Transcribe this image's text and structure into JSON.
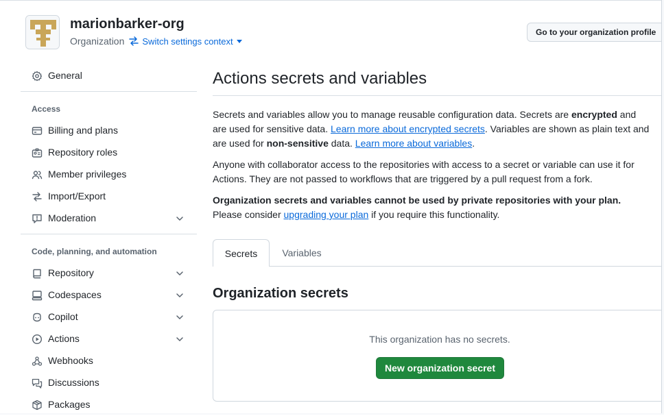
{
  "header": {
    "org_name": "marionbarker-org",
    "org_type": "Organization",
    "switch_label": "Switch settings context",
    "profile_button": "Go to your organization profile"
  },
  "sidebar": {
    "general": "General",
    "access_heading": "Access",
    "access_items": [
      {
        "label": "Billing and plans",
        "icon": "credit-card-icon"
      },
      {
        "label": "Repository roles",
        "icon": "id-badge-icon"
      },
      {
        "label": "Member privileges",
        "icon": "people-icon"
      },
      {
        "label": "Import/Export",
        "icon": "arrow-switch-icon"
      },
      {
        "label": "Moderation",
        "icon": "report-icon"
      }
    ],
    "code_heading": "Code, planning, and automation",
    "code_items": [
      {
        "label": "Repository",
        "icon": "repo-icon"
      },
      {
        "label": "Codespaces",
        "icon": "codespaces-icon"
      },
      {
        "label": "Copilot",
        "icon": "copilot-icon"
      },
      {
        "label": "Actions",
        "icon": "play-icon"
      },
      {
        "label": "Webhooks",
        "icon": "webhook-icon"
      },
      {
        "label": "Discussions",
        "icon": "comment-discussion-icon"
      },
      {
        "label": "Packages",
        "icon": "package-icon"
      }
    ]
  },
  "main": {
    "title": "Actions secrets and variables",
    "para1_a": "Secrets and variables allow you to manage reusable configuration data. Secrets are ",
    "para1_b": "encrypted",
    "para1_c": " and",
    "para1_d": "are used for sensitive data. ",
    "para1_link1": "Learn more about encrypted secrets",
    "para1_e": ". Variables are shown as plain text and",
    "para1_f": "are used for ",
    "para1_g": "non-sensitive",
    "para1_h": " data. ",
    "para1_link2": "Learn more about variables",
    "para1_i": ".",
    "para2_a": "Anyone with collaborator access to the repositories with access to a secret or variable can use it for",
    "para2_b": "Actions. They are not passed to workflows that are triggered by a pull request from a fork.",
    "para3_bold": "Organization secrets and variables cannot be used by private repositories with your plan.",
    "para3_a": "Please consider ",
    "para3_link": "upgrading your plan",
    "para3_b": " if you require this functionality.",
    "tabs": [
      "Secrets",
      "Variables"
    ],
    "section_title": "Organization secrets",
    "empty_text": "This organization has no secrets.",
    "new_button": "New organization secret"
  },
  "colors": {
    "accent": "#0969da",
    "primary_button": "#1f883d",
    "logo_gold": "#c9a659"
  }
}
